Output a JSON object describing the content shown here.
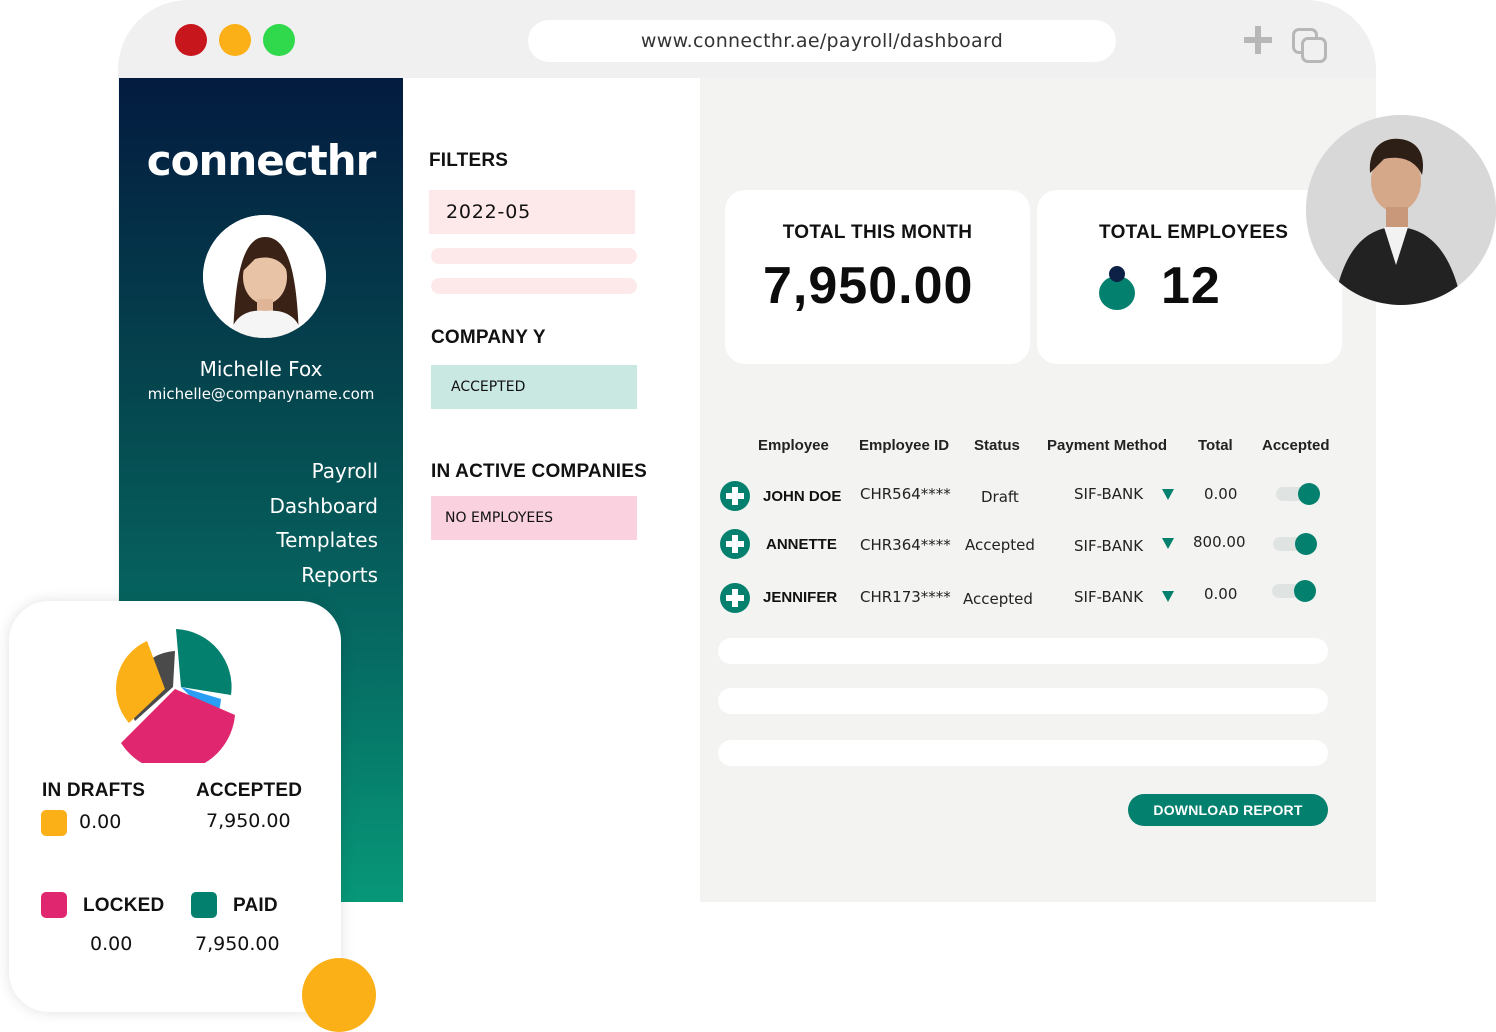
{
  "browser": {
    "url": "www.connecthr.ae/payroll/dashboard"
  },
  "sidebar": {
    "logo": "connecthr",
    "user_name": "Michelle Fox",
    "user_email": "michelle@companyname.com",
    "nav": [
      "Payroll",
      "Dashboard",
      "Templates",
      "Reports"
    ]
  },
  "filters": {
    "title": "FILTERS",
    "date_value": "2022-05",
    "company_title": "COMPANY Y",
    "company_status": "ACCEPTED",
    "inactive_title": "IN ACTIVE COMPANIES",
    "inactive_status": "NO EMPLOYEES"
  },
  "stats": {
    "total_month_label": "TOTAL THIS MONTH",
    "total_month_value": "7,950.00",
    "total_employees_label": "TOTAL EMPLOYEES",
    "total_employees_value": "12"
  },
  "table": {
    "headers": [
      "Employee",
      "Employee ID",
      "Status",
      "Payment Method",
      "Total",
      "Accepted"
    ],
    "rows": [
      {
        "name": "JOHN DOE",
        "id": "CHR564****",
        "status": "Draft",
        "method": "SIF-BANK",
        "total": "0.00",
        "accepted": true
      },
      {
        "name": "ANNETTE",
        "id": "CHR364****",
        "status": "Accepted",
        "method": "SIF-BANK",
        "total": "800.00",
        "accepted": true
      },
      {
        "name": "JENNIFER",
        "id": "CHR173****",
        "status": "Accepted",
        "method": "SIF-BANK",
        "total": "0.00",
        "accepted": true
      }
    ],
    "download_label": "DOWNLOAD REPORT"
  },
  "summary": {
    "in_drafts_label": "IN DRAFTS",
    "in_drafts_value": "0.00",
    "accepted_label": "ACCEPTED",
    "accepted_value": "7,950.00",
    "locked_label": "LOCKED",
    "locked_value": "0.00",
    "paid_label": "PAID",
    "paid_value": "7,950.00"
  },
  "colors": {
    "brand_green": "#04806e",
    "draft_yellow": "#fbb017",
    "locked_pink": "#e0266e",
    "accent_blue": "#2a9df4",
    "dark_gray": "#4a4a4a"
  }
}
